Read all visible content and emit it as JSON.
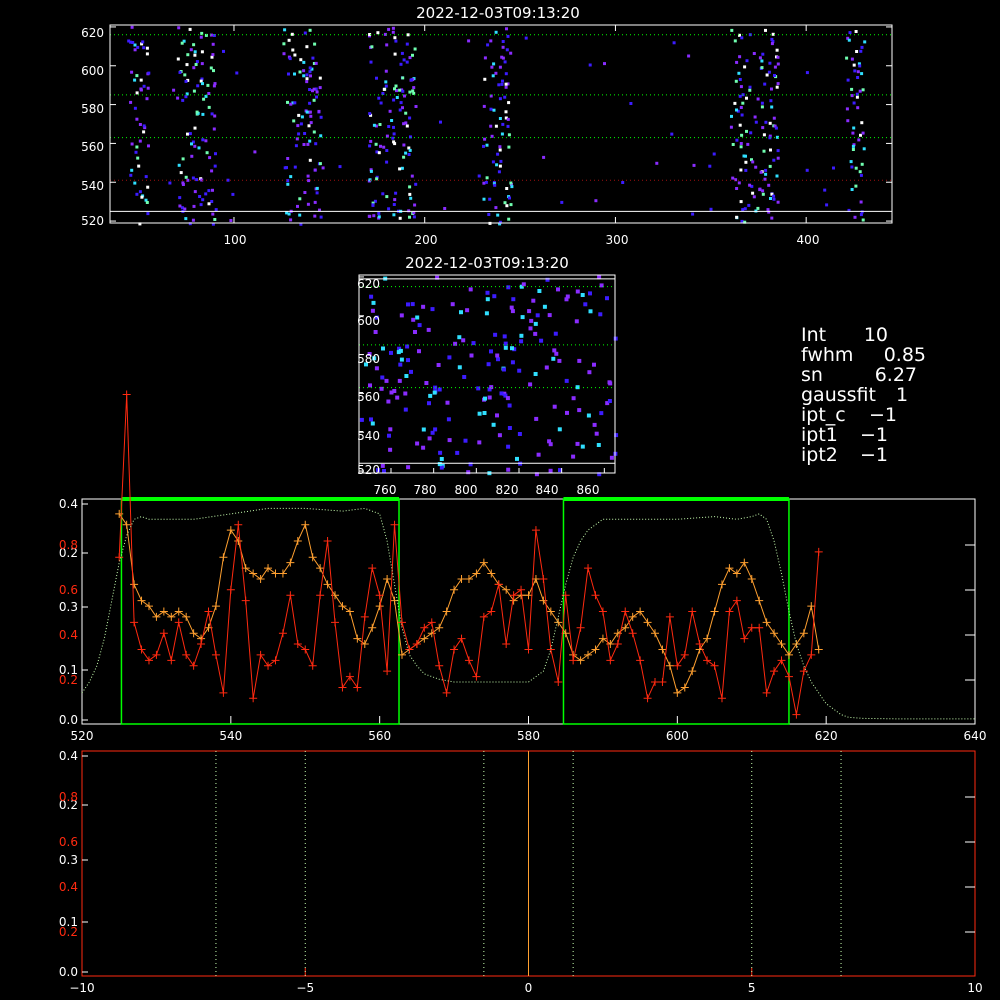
{
  "colors": {
    "white": "#ffffff",
    "red": "#ff2a10",
    "orange": "#ffa030",
    "green": "#00ff00",
    "light_green": "#c8ffb0",
    "dark_red": "#a01010",
    "blue": "#3c1cff",
    "violet": "#8a2cff",
    "cyan": "#30e0ff",
    "mint": "#70ffb0"
  },
  "panel1": {
    "title": "2022-12-03T09:13:20",
    "xticks": [
      "100",
      "200",
      "300",
      "400"
    ],
    "yticks": [
      "520",
      "540",
      "560",
      "580",
      "600",
      "620"
    ]
  },
  "panel2": {
    "title": "2022-12-03T09:13:20",
    "xticks": [
      "760",
      "780",
      "800",
      "820",
      "840",
      "860"
    ],
    "yticks": [
      "520",
      "540",
      "560",
      "580",
      "600",
      "620"
    ]
  },
  "info": [
    {
      "label": "Int",
      "value": "10"
    },
    {
      "label": "fwhm",
      "value": "0.85"
    },
    {
      "label": "sn",
      "value": "6.27"
    },
    {
      "label": "gaussfit",
      "value": "1"
    },
    {
      "label": "ipt_c",
      "value": "−1"
    },
    {
      "label": "ipt1",
      "value": "−1"
    },
    {
      "label": "ipt2",
      "value": "−1"
    }
  ],
  "chart_data": [
    {
      "type": "heatmap",
      "title": "2022-12-03T09:13:20",
      "xlim": [
        35,
        445
      ],
      "ylim": [
        519,
        621
      ],
      "x_ticks": [
        100,
        200,
        300,
        400
      ],
      "y_ticks": [
        520,
        540,
        560,
        580,
        600,
        620
      ],
      "bright_columns": [
        [
          45,
          55
        ],
        [
          70,
          90
        ],
        [
          125,
          145
        ],
        [
          170,
          195
        ],
        [
          230,
          245
        ],
        [
          360,
          385
        ],
        [
          420,
          430
        ]
      ],
      "hlines": [
        {
          "y": 621,
          "color": "white"
        },
        {
          "y": 616,
          "color": "green"
        },
        {
          "y": 585,
          "color": "green"
        },
        {
          "y": 563,
          "color": "green"
        },
        {
          "y": 541,
          "color": "dark_red"
        },
        {
          "y": 525,
          "color": "white"
        }
      ]
    },
    {
      "type": "heatmap",
      "title": "2022-12-03T09:13:20",
      "xlim": [
        745,
        865
      ],
      "ylim": [
        519,
        621
      ],
      "x_ticks": [
        760,
        780,
        800,
        820,
        840,
        860
      ],
      "y_ticks": [
        520,
        540,
        560,
        580,
        600,
        620
      ],
      "hlines": [
        {
          "y": 619,
          "color": "white"
        },
        {
          "y": 615,
          "color": "green"
        },
        {
          "y": 585,
          "color": "green"
        },
        {
          "y": 563,
          "color": "green"
        },
        {
          "y": 524,
          "color": "white"
        }
      ]
    },
    {
      "type": "line",
      "xlim": [
        520,
        640
      ],
      "x_ticks": [
        520,
        540,
        560,
        580,
        600,
        620,
        640
      ],
      "left_ticks_white": [
        "0.0",
        "0.1",
        "0.2",
        "0.3",
        "0.4"
      ],
      "left_ticks_red": [
        "0.2",
        "0.4",
        "0.6",
        "0.8"
      ],
      "green_boxes": [
        [
          525.3,
          562.6
        ],
        [
          584.7,
          615
        ]
      ],
      "series": [
        {
          "color": "orange",
          "marker": "+",
          "x": [
            525,
            526,
            527,
            528,
            529,
            530,
            531,
            532,
            533,
            534,
            535,
            536,
            537,
            538,
            539,
            540,
            541,
            542,
            543,
            544,
            545,
            546,
            547,
            548,
            549,
            550,
            551,
            552,
            553,
            554,
            555,
            556,
            557,
            558,
            559,
            560,
            561,
            562,
            563,
            564,
            565,
            566,
            567,
            568,
            569,
            570,
            571,
            572,
            573,
            574,
            575,
            576,
            577,
            578,
            579,
            580,
            581,
            582,
            583,
            584,
            585,
            586,
            587,
            588,
            589,
            590,
            591,
            592,
            593,
            594,
            595,
            596,
            597,
            598,
            599,
            600,
            601,
            602,
            603,
            604,
            605,
            606,
            607,
            608,
            609,
            610,
            611,
            612,
            613,
            614,
            615,
            616,
            617,
            618,
            619
          ],
          "y": [
            0.38,
            0.36,
            0.25,
            0.22,
            0.21,
            0.19,
            0.2,
            0.19,
            0.2,
            0.19,
            0.16,
            0.15,
            0.17,
            0.21,
            0.3,
            0.35,
            0.33,
            0.28,
            0.27,
            0.26,
            0.28,
            0.27,
            0.27,
            0.29,
            0.33,
            0.36,
            0.3,
            0.28,
            0.25,
            0.23,
            0.21,
            0.2,
            0.15,
            0.14,
            0.17,
            0.21,
            0.26,
            0.22,
            0.12,
            0.13,
            0.14,
            0.15,
            0.16,
            0.17,
            0.2,
            0.24,
            0.26,
            0.26,
            0.27,
            0.29,
            0.27,
            0.25,
            0.24,
            0.22,
            0.23,
            0.23,
            0.26,
            0.22,
            0.2,
            0.18,
            0.16,
            0.12,
            0.11,
            0.12,
            0.13,
            0.15,
            0.14,
            0.16,
            0.17,
            0.19,
            0.2,
            0.18,
            0.16,
            0.13,
            0.1,
            0.05,
            0.06,
            0.09,
            0.13,
            0.15,
            0.2,
            0.25,
            0.28,
            0.27,
            0.29,
            0.26,
            0.22,
            0.18,
            0.16,
            0.14,
            0.12,
            0.14,
            0.16,
            0.21,
            0.13
          ]
        },
        {
          "color": "red",
          "marker": "+",
          "x": [
            525,
            526,
            527,
            528,
            529,
            530,
            531,
            532,
            533,
            534,
            535,
            536,
            537,
            538,
            539,
            540,
            541,
            542,
            543,
            544,
            545,
            546,
            547,
            548,
            549,
            550,
            551,
            552,
            553,
            554,
            555,
            556,
            557,
            558,
            559,
            560,
            561,
            562,
            563,
            564,
            565,
            566,
            567,
            568,
            569,
            570,
            571,
            572,
            573,
            574,
            575,
            576,
            577,
            578,
            579,
            580,
            581,
            582,
            583,
            584,
            585,
            586,
            587,
            588,
            589,
            590,
            591,
            592,
            593,
            594,
            595,
            596,
            597,
            598,
            599,
            600,
            601,
            602,
            603,
            604,
            605,
            606,
            607,
            608,
            609,
            610,
            611,
            612,
            613,
            614,
            615,
            616,
            617,
            618,
            619
          ],
          "y": [
            0.3,
            0.6,
            0.18,
            0.13,
            0.11,
            0.12,
            0.16,
            0.11,
            0.18,
            0.12,
            0.1,
            0.14,
            0.2,
            0.12,
            0.05,
            0.24,
            0.36,
            0.22,
            0.04,
            0.12,
            0.1,
            0.11,
            0.16,
            0.23,
            0.14,
            0.13,
            0.1,
            0.23,
            0.33,
            0.18,
            0.06,
            0.08,
            0.06,
            0.19,
            0.28,
            0.23,
            0.09,
            0.36,
            0.18,
            0.13,
            0.14,
            0.17,
            0.18,
            0.1,
            0.05,
            0.13,
            0.15,
            0.11,
            0.08,
            0.19,
            0.2,
            0.25,
            0.14,
            0.23,
            0.24,
            0.13,
            0.35,
            0.26,
            0.13,
            0.07,
            0.23,
            0.11,
            0.17,
            0.28,
            0.23,
            0.2,
            0.11,
            0.14,
            0.2,
            0.16,
            0.11,
            0.04,
            0.07,
            0.07,
            0.19,
            0.1,
            0.12,
            0.2,
            0.14,
            0.11,
            0.1,
            0.04,
            0.2,
            0.22,
            0.15,
            0.17,
            0.17,
            0.05,
            0.09,
            0.11,
            0.08,
            0.01,
            0.09,
            0.12,
            0.31
          ]
        },
        {
          "color": "light_green",
          "dotted": true,
          "x": [
            520,
            521,
            522,
            523,
            524,
            525,
            526,
            527,
            528,
            529,
            530,
            535,
            540,
            545,
            550,
            555,
            558,
            560,
            561,
            562,
            563,
            564,
            565,
            566,
            567,
            568,
            570,
            575,
            580,
            582,
            583,
            584,
            585,
            586,
            587,
            588,
            590,
            595,
            600,
            605,
            608,
            610,
            611,
            612,
            613,
            614,
            615,
            616,
            617,
            618,
            619,
            620,
            621,
            622,
            623,
            625,
            630,
            635,
            640
          ],
          "y": [
            0.05,
            0.07,
            0.1,
            0.15,
            0.22,
            0.29,
            0.34,
            0.37,
            0.375,
            0.37,
            0.37,
            0.37,
            0.38,
            0.39,
            0.39,
            0.385,
            0.39,
            0.38,
            0.33,
            0.25,
            0.17,
            0.12,
            0.1,
            0.085,
            0.08,
            0.075,
            0.07,
            0.07,
            0.07,
            0.09,
            0.13,
            0.19,
            0.25,
            0.3,
            0.33,
            0.35,
            0.37,
            0.37,
            0.37,
            0.375,
            0.37,
            0.375,
            0.38,
            0.37,
            0.33,
            0.27,
            0.2,
            0.14,
            0.1,
            0.07,
            0.05,
            0.03,
            0.02,
            0.01,
            0.005,
            0.003,
            0.002,
            0.002,
            0.002
          ]
        }
      ]
    },
    {
      "type": "line",
      "xlim": [
        -10,
        10
      ],
      "x_ticks": [
        -10,
        -5,
        0,
        5,
        10
      ],
      "left_ticks_white": [
        "0.0",
        "0.1",
        "0.2",
        "0.3",
        "0.4"
      ],
      "left_ticks_red": [
        "0.2",
        "0.4",
        "0.6",
        "0.8"
      ],
      "vlines": [
        {
          "x": -7,
          "style": "dotted",
          "color": "light_green"
        },
        {
          "x": -5,
          "style": "dotted",
          "color": "light_green"
        },
        {
          "x": -1,
          "style": "dotted",
          "color": "light_green"
        },
        {
          "x": 0,
          "style": "solid",
          "color": "orange"
        },
        {
          "x": 1,
          "style": "dotted",
          "color": "light_green"
        },
        {
          "x": 5,
          "style": "dotted",
          "color": "light_green"
        },
        {
          "x": 7,
          "style": "dotted",
          "color": "light_green"
        }
      ]
    }
  ]
}
